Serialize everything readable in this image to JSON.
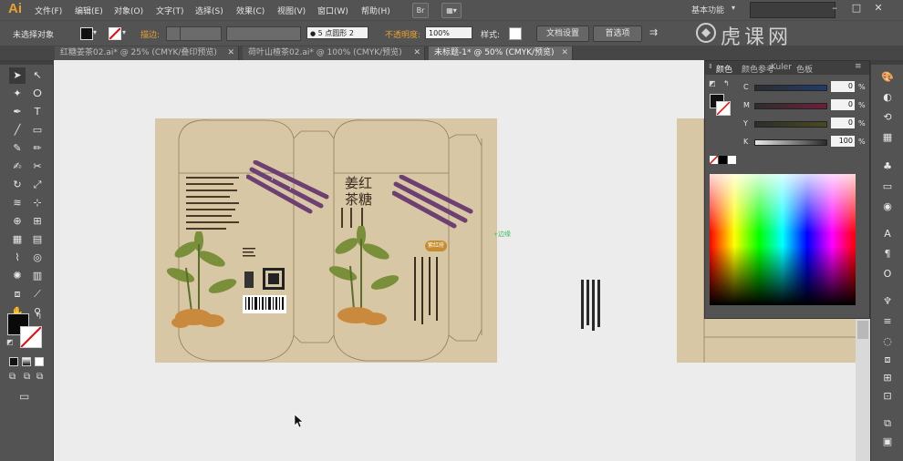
{
  "app": {
    "logo": "Ai",
    "menus": [
      "文件(F)",
      "编辑(E)",
      "对象(O)",
      "文字(T)",
      "选择(S)",
      "效果(C)",
      "视图(V)",
      "窗口(W)",
      "帮助(H)"
    ],
    "bridge": "Br",
    "workspace": "基本功能",
    "watermark": "虎课网"
  },
  "control": {
    "selection": "未选择对象",
    "stroke_label": "描边:",
    "brush": "5 点圆形",
    "brush_num": "2",
    "opacity_label": "不透明度:",
    "opacity_value": "100%",
    "style_label": "样式:",
    "doc_setup": "文档设置",
    "preferences": "首选项"
  },
  "tabs": [
    {
      "label": "红糖姜茶02.ai* @ 25% (CMYK/叠印预览)",
      "active": false
    },
    {
      "label": "荷叶山楂茶02.ai* @ 100% (CMYK/预览)",
      "active": false
    },
    {
      "label": "未标题-1* @ 50% (CMYK/预览)",
      "active": true
    }
  ],
  "canvas": {
    "product_title_1": "姜红",
    "product_title_2": "茶糖",
    "badge": "紫红府",
    "guide_label": "边缘"
  },
  "color_panel": {
    "tabs": [
      "颜色",
      "颜色参考",
      "Kuler",
      "色板"
    ],
    "channels": [
      {
        "label": "C",
        "value": "0",
        "unit": "%"
      },
      {
        "label": "M",
        "value": "0",
        "unit": "%"
      },
      {
        "label": "Y",
        "value": "0",
        "unit": "%"
      },
      {
        "label": "K",
        "value": "100",
        "unit": "%"
      }
    ]
  },
  "colors": {
    "ui_dark": "#535353",
    "kraft": "#d8c7a4",
    "accent": "#e8a233"
  }
}
